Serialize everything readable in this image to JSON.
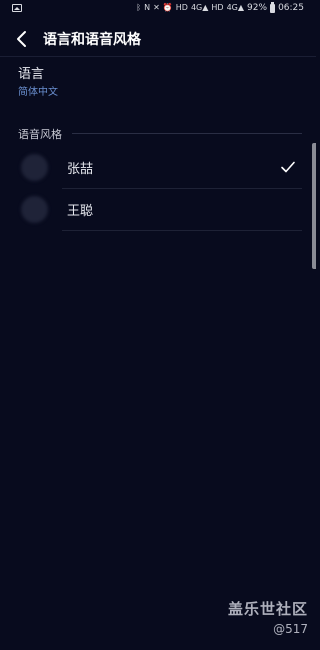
{
  "status_bar": {
    "icons": [
      "gallery-icon",
      "bluetooth-icon",
      "nfc-icon",
      "mute-icon",
      "alarm-icon",
      "hd-icon",
      "4g-signal-icon",
      "hd-icon",
      "4g-signal-icon"
    ],
    "battery": "92%",
    "time": "06:25"
  },
  "app_bar": {
    "title": "语言和语音风格"
  },
  "language": {
    "title": "语言",
    "value": "简体中文"
  },
  "voice_style": {
    "header": "语音风格",
    "items": [
      {
        "name": "张喆",
        "selected": true
      },
      {
        "name": "王聪",
        "selected": false
      }
    ]
  },
  "watermark": {
    "title": "盖乐世社区",
    "user": "@517"
  },
  "colors": {
    "background": "#080b1e",
    "accent": "#6a8fd0",
    "text": "#e8eaf0"
  }
}
